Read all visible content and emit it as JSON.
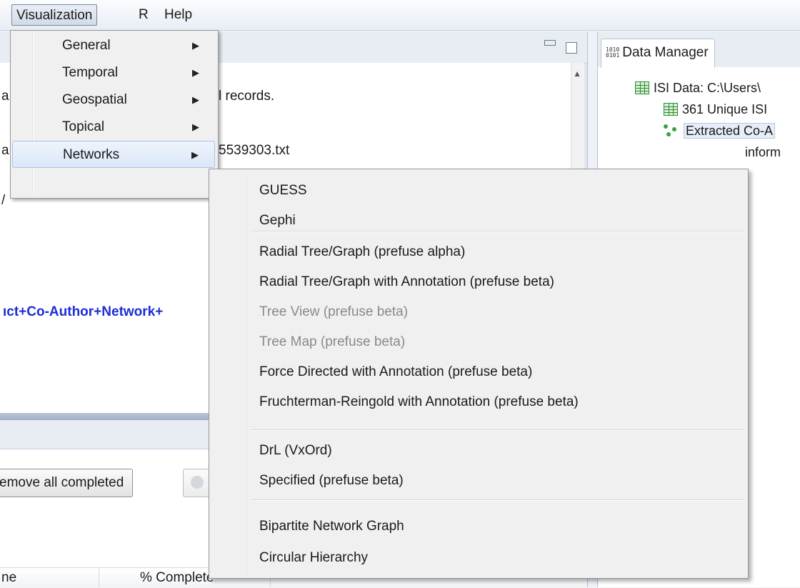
{
  "menubar": {
    "items": [
      {
        "label": "Visualization"
      },
      {
        "label": "R"
      },
      {
        "label": "Help"
      }
    ]
  },
  "editor": {
    "console_lines": [
      "l records.",
      "5539303.txt"
    ],
    "link_text": "ıct+Co-Author+Network+",
    "left_fragments": [
      "a",
      "a",
      "/"
    ]
  },
  "lower": {
    "remove_button": "emove all completed",
    "col_name_fragment": "ne",
    "col_complete": "% Complete"
  },
  "data_manager": {
    "tab_label": "Data Manager",
    "tab_glyph_top": "1010",
    "tab_glyph_bottom": "0101",
    "tree": [
      {
        "label": "ISI Data: C:\\Users\\"
      },
      {
        "label": "361 Unique ISI"
      },
      {
        "label": "Extracted Co-A"
      },
      {
        "label": "inform"
      }
    ]
  },
  "visualization_menu": {
    "items": [
      {
        "label": "General",
        "arrow": "▶"
      },
      {
        "label": "Temporal",
        "arrow": "▶"
      },
      {
        "label": "Geospatial",
        "arrow": "▶"
      },
      {
        "label": "Topical",
        "arrow": "▶"
      },
      {
        "label": "Networks",
        "arrow": "▶",
        "highlighted": true
      }
    ]
  },
  "networks_submenu": {
    "items": [
      {
        "label": "GUESS",
        "enabled": true
      },
      {
        "label": "Gephi",
        "enabled": true
      },
      {
        "label": "Radial Tree/Graph (prefuse alpha)",
        "enabled": true
      },
      {
        "label": "Radial Tree/Graph with Annotation (prefuse beta)",
        "enabled": true
      },
      {
        "label": "Tree View (prefuse beta)",
        "enabled": false
      },
      {
        "label": "Tree Map (prefuse beta)",
        "enabled": false
      },
      {
        "label": "Force Directed with Annotation (prefuse beta)",
        "enabled": true
      },
      {
        "label": "Fruchterman-Reingold with Annotation (prefuse beta)",
        "enabled": true
      },
      {
        "label": "DrL (VxOrd)",
        "enabled": true
      },
      {
        "label": "Specified (prefuse beta)",
        "enabled": true
      },
      {
        "label": "Bipartite Network Graph",
        "enabled": true
      },
      {
        "label": "Circular Hierarchy",
        "enabled": true
      }
    ]
  }
}
